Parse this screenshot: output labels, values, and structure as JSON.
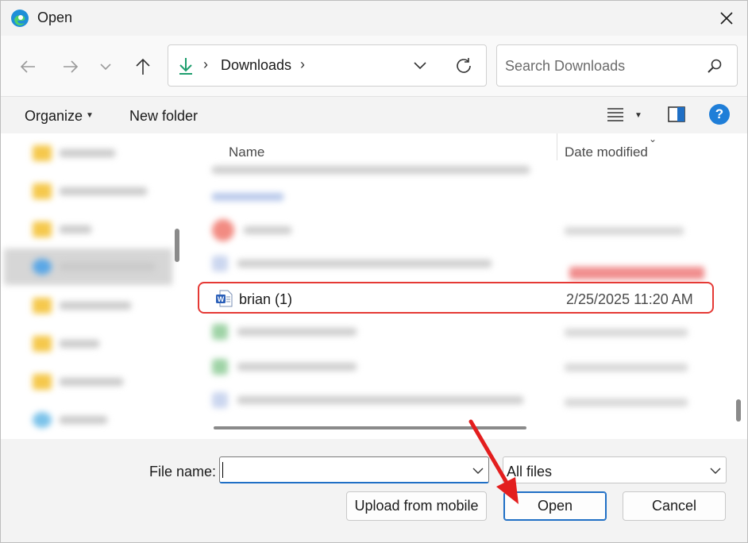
{
  "window": {
    "title": "Open",
    "app_icon": "edge-icon",
    "close_icon": "close-icon"
  },
  "nav": {
    "back_icon": "arrow-left-icon",
    "forward_icon": "arrow-right-icon",
    "recent_icon": "chevron-down-icon",
    "up_icon": "arrow-up-icon",
    "address": {
      "location_icon": "download-icon",
      "path": "Downloads",
      "separator": "›"
    },
    "search": {
      "placeholder": "Search Downloads",
      "icon": "search-icon"
    }
  },
  "commandbar": {
    "organize_label": "Organize",
    "new_folder_label": "New folder",
    "view_icon": "view-list-icon",
    "preview_icon": "preview-pane-icon",
    "help_label": "?"
  },
  "files": {
    "columns": {
      "name": "Name",
      "date_modified": "Date modified"
    },
    "highlighted_item": {
      "name": "brian (1)",
      "date": "2/25/2025 11:20 AM",
      "icon": "word-document-icon"
    }
  },
  "bottom": {
    "file_name_label": "File name:",
    "file_name_value": "",
    "file_type": "All files",
    "upload_label": "Upload from mobile",
    "open_label": "Open",
    "cancel_label": "Cancel"
  },
  "colors": {
    "highlight_border": "#e53935",
    "accent": "#1f6fc5",
    "annotation_arrow": "#e31e1e"
  }
}
